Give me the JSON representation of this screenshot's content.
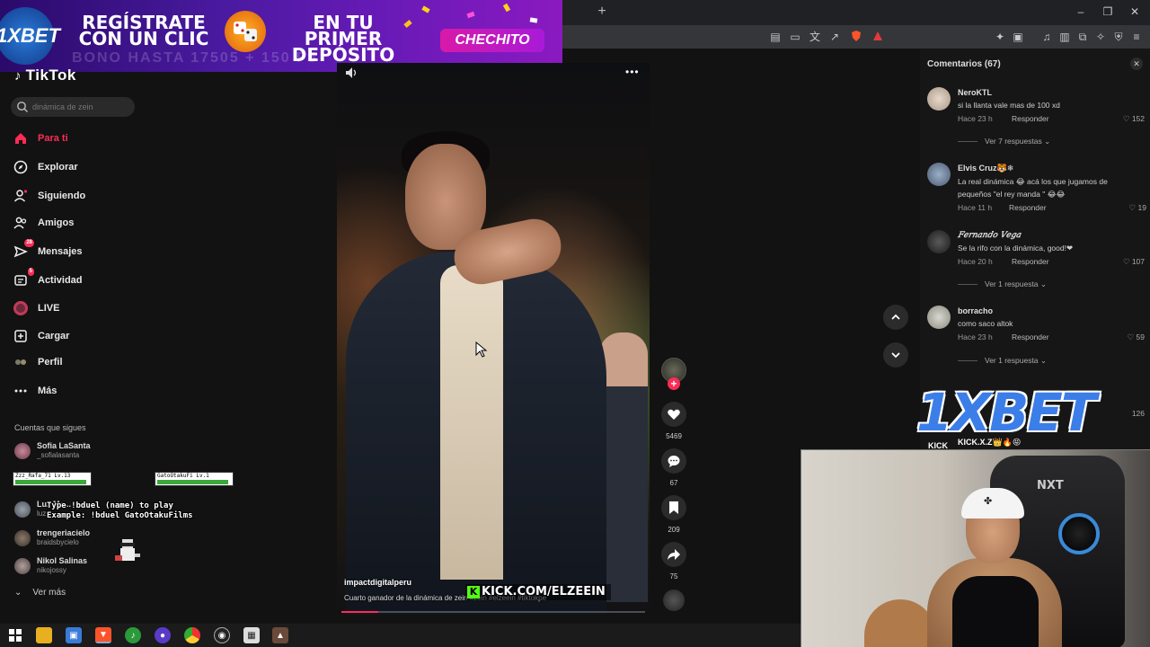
{
  "ad": {
    "brand": "1XBET",
    "line1": "REGÍSTRATE CON UN CLIC",
    "line2": "EN TU PRIMER DEPÓSITO",
    "cta": "CHECHITO",
    "faded_text": "BONO HASTA 17505 + 150 FS"
  },
  "browser": {
    "new_tab": "+",
    "minimize": "–",
    "restore": "❐",
    "close": "✕"
  },
  "sidebar": {
    "logo": "TikTok",
    "search_placeholder": "dinámica de zein",
    "nav": [
      {
        "label": "Para ti",
        "icon": "home-icon"
      },
      {
        "label": "Explorar",
        "icon": "compass-icon"
      },
      {
        "label": "Siguiendo",
        "icon": "following-icon"
      },
      {
        "label": "Amigos",
        "icon": "friends-icon"
      },
      {
        "label": "Mensajes",
        "icon": "messages-icon",
        "badge": "28"
      },
      {
        "label": "Actividad",
        "icon": "activity-icon",
        "badge": "5"
      },
      {
        "label": "LIVE",
        "icon": "live-icon"
      },
      {
        "label": "Cargar",
        "icon": "upload-icon"
      },
      {
        "label": "Perfil",
        "icon": "profile-icon"
      },
      {
        "label": "Más",
        "icon": "more-icon"
      }
    ],
    "following_title": "Cuentas que sigues",
    "following": [
      {
        "name": "Sofia LaSanta",
        "user": "_sofialasanta"
      },
      {
        "name": "Luz Ma...",
        "user": "luz..."
      },
      {
        "name": "trengeriacielo",
        "user": "braidsbycielo"
      },
      {
        "name": "Nikol Salinas",
        "user": "nikojossy"
      }
    ],
    "see_more": "Ver más"
  },
  "game_overlay": {
    "player1": "Zzz_Rafa_71 Lv.13",
    "player2": "GatoOtakuFi Lv.1",
    "line1": "Type !bduel (name) to play",
    "line2": "Example: !bduel GatoOtakuFilms",
    "player1_hp": 0.96,
    "player2_hp": 0.96
  },
  "video": {
    "author": "impactdigitalperu",
    "caption": "Cuarto ganador de la dinámica de zein #zein #elzeein #tiktokpe",
    "watermark": "KICK.COM/ELZEEIN",
    "progress": 0.12,
    "likes": "5469",
    "comments": "67",
    "saves": "209",
    "shares": "75"
  },
  "comments": {
    "title": "Comentarios (67)",
    "items": [
      {
        "name": "NeroKTL",
        "text": "si la llanta vale mas de 100 xd",
        "time": "Hace 23 h",
        "reply": "Responder",
        "likes": "152",
        "replies": "Ver 7 respuestas"
      },
      {
        "name": "Elvis Cruz🐯❄",
        "text": "La real dinámica 😂 acá los que jugamos de pequeños \"el rey manda \" 😂😂",
        "time": "Hace 11 h",
        "reply": "Responder",
        "likes": "19",
        "replies": ""
      },
      {
        "name": "𝐹𝑒𝑟𝑛𝑎𝑛𝑑𝑜 𝑉𝑒𝑔𝑎",
        "text": "Se la rifo con la dinámica, good!❤",
        "time": "Hace 20 h",
        "reply": "Responder",
        "likes": "107",
        "replies": "Ver 1 respuesta"
      },
      {
        "name": "borracho",
        "text": "como saco altok",
        "time": "Hace 23 h",
        "reply": "Responder",
        "likes": "59",
        "replies": "Ver 1 respuesta"
      }
    ],
    "partial_likes": "126"
  },
  "overlay_brand": {
    "logo": "1XBET",
    "kick_label": "KICK",
    "kick_user": "KICK.X.Z👑🔥😝"
  },
  "webcam": {
    "chair_logo": "NXT",
    "cap_logo": "✤"
  },
  "colors": {
    "accent": "#fe2c55",
    "kick_green": "#53fc18",
    "bet_blue": "#3c7ee8"
  }
}
